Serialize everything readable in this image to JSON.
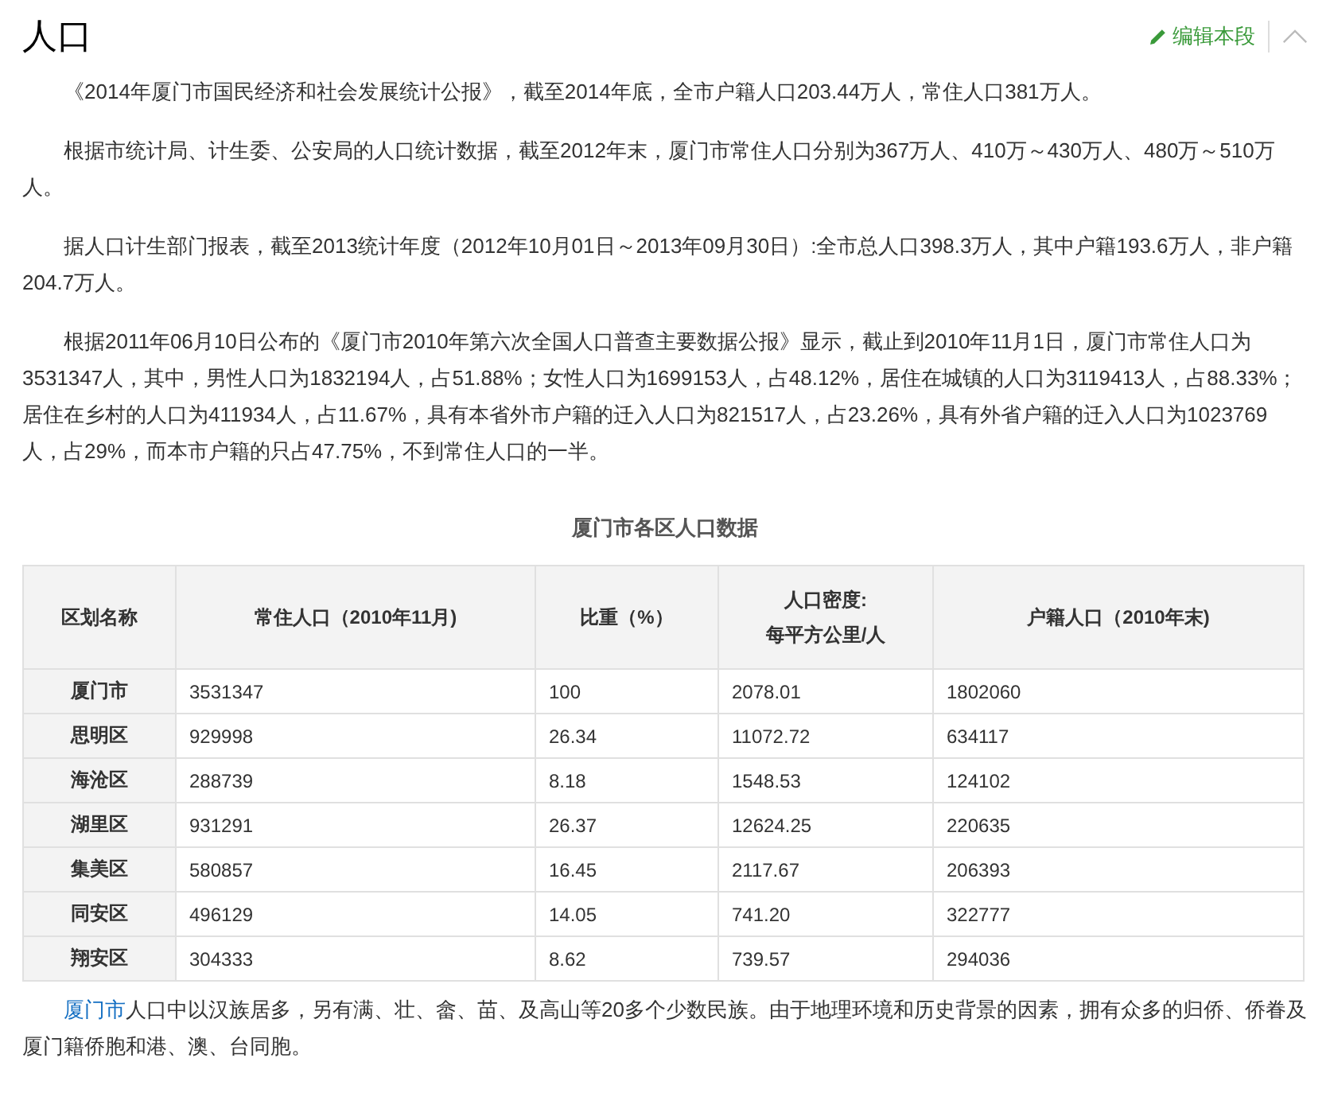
{
  "section": {
    "title": "人口",
    "edit_link": "编辑本段",
    "collapsed": false
  },
  "paragraphs": [
    "《2014年厦门市国民经济和社会发展统计公报》，截至2014年底，全市户籍人口203.44万人，常住人口381万人。",
    "根据市统计局、计生委、公安局的人口统计数据，截至2012年末，厦门市常住人口分别为367万人、410万～430万人、480万～510万人。",
    "据人口计生部门报表，截至2013统计年度（2012年10月01日～2013年09月30日）:全市总人口398.3万人，其中户籍193.6万人，非户籍204.7万人。",
    "根据2011年06月10日公布的《厦门市2010年第六次全国人口普查主要数据公报》显示，截止到2010年11月1日，厦门市常住人口为3531347人，其中，男性人口为1832194人，占51.88%；女性人口为1699153人，占48.12%，居住在城镇的人口为3119413人，占88.33%；居住在乡村的人口为411934人，占11.67%，具有本省外市户籍的迁入人口为821517人，占23.26%，具有外省户籍的迁入人口为1023769人，占29%，而本市户籍的只占47.75%，不到常住人口的一半。"
  ],
  "table": {
    "title": "厦门市各区人口数据",
    "columns": [
      "区划名称",
      "常住人口（2010年11月)",
      "比重（%）",
      "人口密度:\n每平方公里/人",
      "户籍人口（2010年末)"
    ],
    "rows": [
      [
        "厦门市",
        "3531347",
        "100",
        "2078.01",
        "1802060"
      ],
      [
        "思明区",
        "929998",
        "26.34",
        "11072.72",
        "634117"
      ],
      [
        "海沧区",
        "288739",
        "8.18",
        "1548.53",
        "124102"
      ],
      [
        "湖里区",
        "931291",
        "26.37",
        "12624.25",
        "220635"
      ],
      [
        "集美区",
        "580857",
        "16.45",
        "2117.67",
        "206393"
      ],
      [
        "同安区",
        "496129",
        "14.05",
        "741.20",
        "322777"
      ],
      [
        "翔安区",
        "304333",
        "8.62",
        "739.57",
        "294036"
      ]
    ]
  },
  "closing": {
    "link": "厦门市",
    "text": "人口中以汉族居多，另有满、壮、畲、苗、及高山等20多个少数民族。由于地理环境和历史背景的因素，拥有众多的归侨、侨眷及厦门籍侨胞和港、澳、台同胞。"
  }
}
